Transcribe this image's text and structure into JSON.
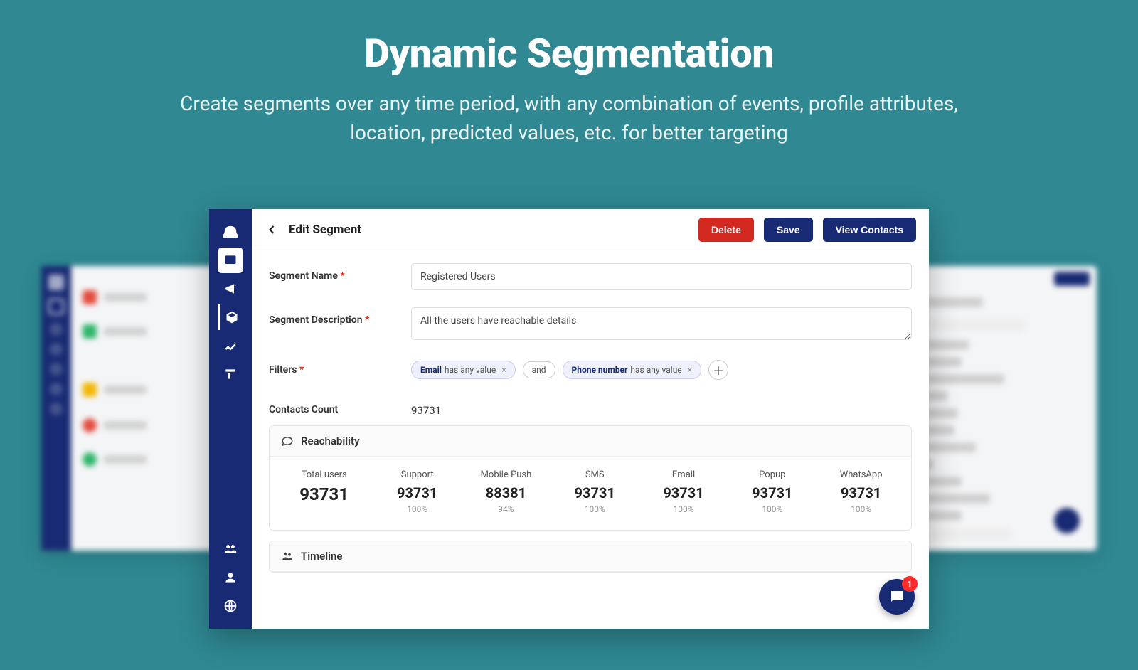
{
  "hero": {
    "title": "Dynamic Segmentation",
    "subtitle": "Create segments over any time period, with any combination of events, profile attributes, location, predicted values, etc. for better targeting"
  },
  "app": {
    "topbar": {
      "title": "Edit Segment",
      "delete": "Delete",
      "save": "Save",
      "view_contacts": "View Contacts"
    },
    "labels": {
      "segment_name": "Segment Name",
      "segment_description": "Segment Description",
      "filters": "Filters",
      "contacts_count": "Contacts Count",
      "reachability": "Reachability",
      "timeline": "Timeline",
      "and": "and"
    },
    "values": {
      "segment_name": "Registered Users",
      "segment_description": "All the users have reachable details",
      "contacts_count": "93731"
    },
    "filters": [
      {
        "key": "Email",
        "op": "has any value"
      },
      {
        "key": "Phone number",
        "op": "has any value"
      }
    ],
    "reachability": {
      "total": {
        "label": "Total users",
        "value": "93731"
      },
      "channels": [
        {
          "label": "Support",
          "value": "93731",
          "pct": "100%"
        },
        {
          "label": "Mobile Push",
          "value": "88381",
          "pct": "94%"
        },
        {
          "label": "SMS",
          "value": "93731",
          "pct": "100%"
        },
        {
          "label": "Email",
          "value": "93731",
          "pct": "100%"
        },
        {
          "label": "Popup",
          "value": "93731",
          "pct": "100%"
        },
        {
          "label": "WhatsApp",
          "value": "93731",
          "pct": "100%"
        }
      ]
    },
    "chat_badge": "1"
  }
}
